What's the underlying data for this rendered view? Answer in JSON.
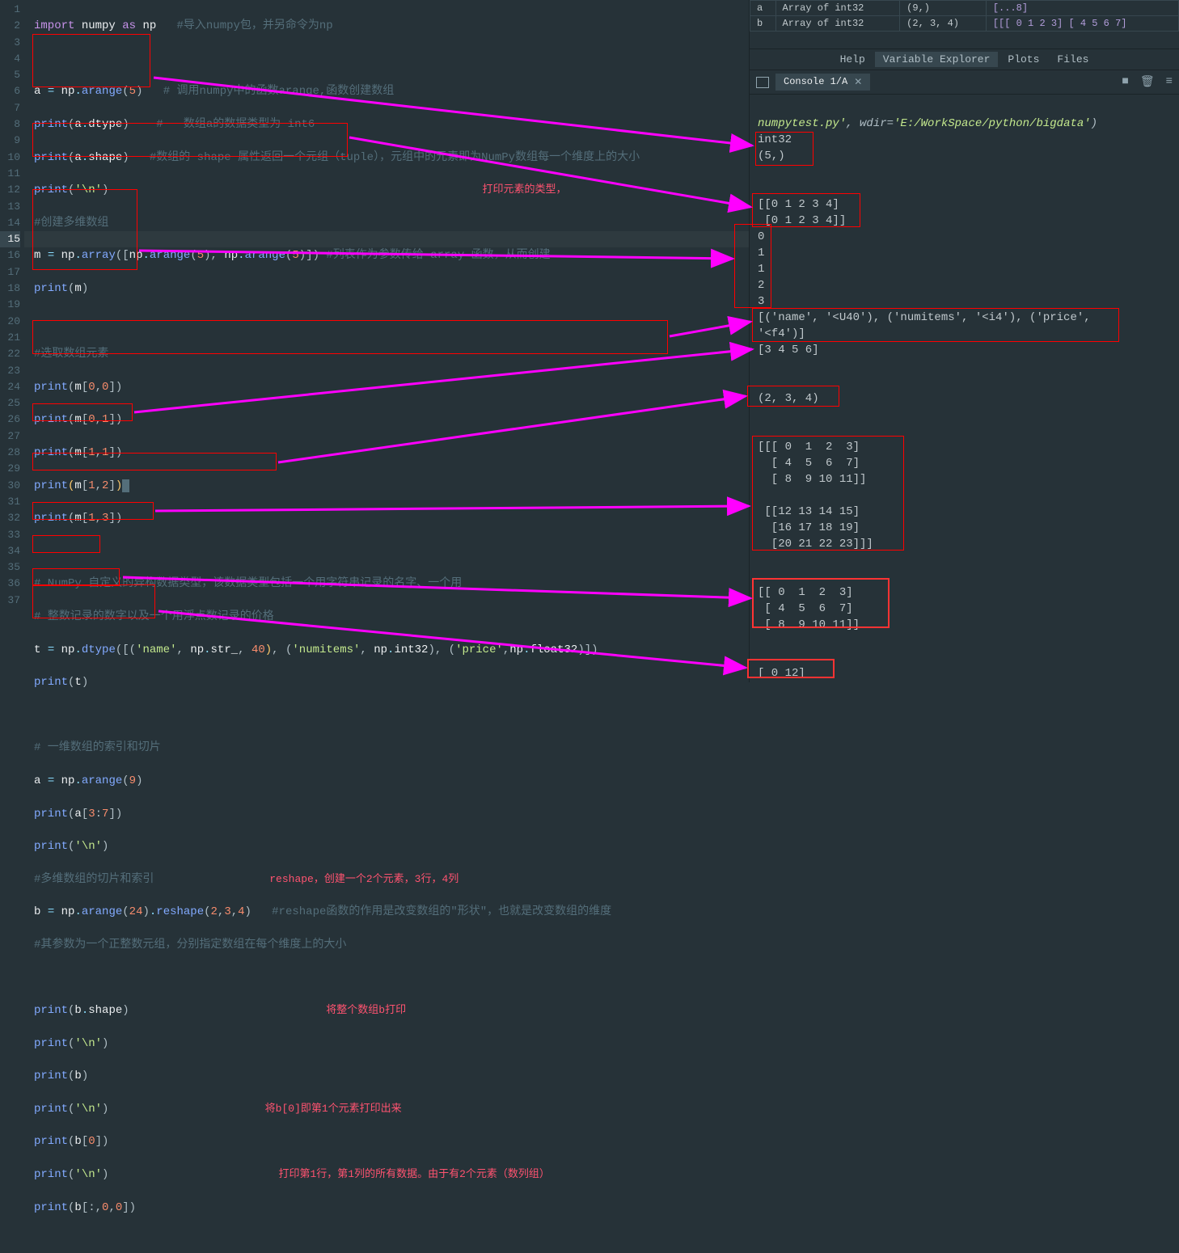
{
  "editor": {
    "line_count": 37,
    "highlighted_line": 15,
    "annotations": {
      "type_print": "打印元素的类型，",
      "reshape": "reshape，创建一个2个元素，3行，4列",
      "print_b": "将整个数组b打印",
      "print_b0": "将b[0]即第1个元素打印出来",
      "print_slice": "打印第1行，第1列的所有数据。由于有2个元素（数列组）"
    },
    "code": {
      "l1_import": "import",
      "l1_numpy": "numpy",
      "l1_as": "as",
      "l1_np": "np",
      "l1_cmt": "#导入numpy包，并另命令为np",
      "l3": "a = np.arange(5)",
      "l3_cmt": "# 调用numpy中的函数arange,函数创建数组",
      "l4": "print(a.dtype)",
      "l4_cmt": "#   数组a的数据类型为 int6",
      "l5": "print(a.shape)",
      "l5_cmt": "#数组的 shape 属性返回一个元组（tuple），元组中的元素即为NumPy数组每一个维度上的大小",
      "l6": "print('\\n')",
      "l7_cmt": "#创建多维数组",
      "l8": "m = np.array([np.arange(5), np.arange(5)])",
      "l8_cmt": "#列表作为参数传给 array 函数，从而创建    ",
      "l9": "print(m)",
      "l11_cmt": "#选取数组元素",
      "l12": "print(m[0,0])",
      "l13": "print(m[0,1])",
      "l14": "print(m[1,1])",
      "l15": "print(m[1,2])",
      "l16": "print(m[1,3])",
      "l18_cmt": "# NumPy 自定义的异构数据类型，该数据类型包括一个用字符串记录的名字、一个用",
      "l19_cmt": "# 整数记录的数字以及一个用浮点数记录的价格",
      "l20": "t = np.dtype([('name', np.str_, 40), ('numitems', np.int32), ('price',np.float32)])",
      "l21": "print(t)",
      "l23_cmt": "# 一维数组的索引和切片",
      "l24": "a = np.arange(9)",
      "l25": "print(a[3:7])",
      "l26": "print('\\n')",
      "l27_cmt": "#多维数组的切片和索引",
      "l28": "b = np.arange(24).reshape(2,3,4)",
      "l28_cmt": "#reshape函数的作用是改变数组的\"形状\"，也就是改变数组的维度",
      "l29_cmt": "#其参数为一个正整数元组，分别指定数组在每个维度上的大小",
      "l31": "print(b.shape)",
      "l32": "print('\\n')",
      "l33": "print(b)",
      "l34": "print('\\n')",
      "l35": "print(b[0])",
      "l36": "print('\\n')",
      "l37": "print(b[:,0,0])"
    }
  },
  "variable_explorer": {
    "rows": [
      {
        "name": "a",
        "type": "Array of int32",
        "shape": "(9,)",
        "val": "[...8]"
      },
      {
        "name": "b",
        "type": "Array of int32",
        "shape": "(2, 3, 4)",
        "val": "[[[ 0  1  2  3]\n  [ 4  5  6  7]"
      }
    ]
  },
  "tabs": {
    "help": "Help",
    "varexp": "Variable Explorer",
    "plots": "Plots",
    "files": "Files"
  },
  "console": {
    "tab": "Console 1/A",
    "run_line_pre": "numpytest.py'",
    "run_line_mid": ", wdir=",
    "run_line_path": "'E:/WorkSpace/python/bigdata'",
    "run_line_end": ")",
    "out": {
      "dtype": "int32",
      "shape5": "(5,)",
      "m_arr": "[[0 1 2 3 4]\n [0 1 2 3 4]]",
      "idx": "0\n1\n1\n2\n3",
      "dtype_t": "[('name', '<U40'), ('numitems', '<i4'), ('price',\n'<f4')]",
      "slice": "[3 4 5 6]",
      "shape_b": "(2, 3, 4)",
      "arr_b": "[[[ 0  1  2  3]\n  [ 4  5  6  7]\n  [ 8  9 10 11]]\n\n [[12 13 14 15]\n  [16 17 18 19]\n  [20 21 22 23]]]",
      "b0": "[[ 0  1  2  3]\n [ 4  5  6  7]\n [ 8  9 10 11]]",
      "b_slice": "[ 0 12]"
    }
  }
}
